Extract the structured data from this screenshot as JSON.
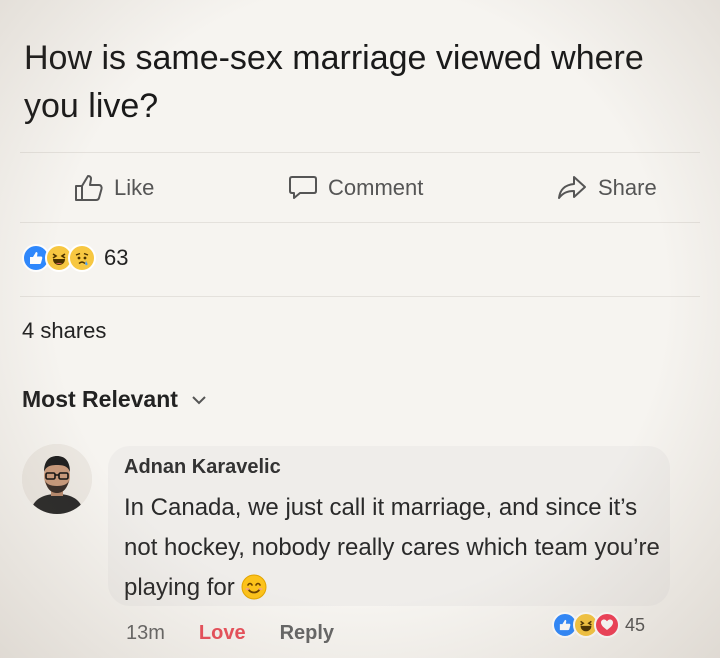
{
  "post": {
    "text": "How is same-sex marriage viewed where you live?"
  },
  "actions": {
    "like_label": "Like",
    "comment_label": "Comment",
    "share_label": "Share"
  },
  "reactions": {
    "icons": [
      "like-icon",
      "haha-icon",
      "sad-icon"
    ],
    "count": "63"
  },
  "shares": {
    "label": "4 shares"
  },
  "comments_section": {
    "sort_label": "Most Relevant"
  },
  "comment": {
    "author": "Adnan Karavelic",
    "text": "In Canada, we just call it marriage, and since it’s not hockey, nobody really cares which team you’re playing for",
    "emoji": "smiling-face-icon",
    "time": "13m",
    "love_label": "Love",
    "reply_label": "Reply",
    "reaction_icons": [
      "like-icon",
      "haha-icon",
      "love-icon"
    ],
    "reaction_count": "45"
  },
  "colors": {
    "like_blue": "#2d88ff",
    "love_red": "#f33e58",
    "love_text": "#e8505b",
    "haha_yellow": "#f7c741"
  }
}
